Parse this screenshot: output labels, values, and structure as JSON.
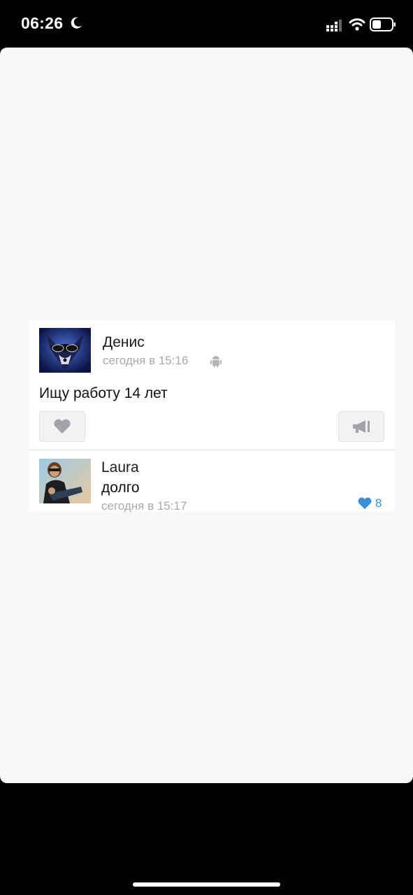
{
  "status_bar": {
    "time": "06:26",
    "icons": [
      "moon-icon",
      "cellular-signal-icon",
      "wifi-icon",
      "battery-icon"
    ]
  },
  "post": {
    "author": "Денис",
    "meta": "сегодня в 15:16",
    "device_icon": "android-icon",
    "text": "Ищу работу 14 лет",
    "like_icon": "heart-icon",
    "share_icon": "megaphone-icon"
  },
  "reply": {
    "author": "Laura",
    "text": "долго",
    "meta": "сегодня в 15:17",
    "likes": "8",
    "like_icon": "heart-icon",
    "like_color": "#3b8fd6"
  },
  "colors": {
    "screen_bg": "#000000",
    "card_bg": "#f8f8fa",
    "meta_text": "#a9a9ad"
  }
}
